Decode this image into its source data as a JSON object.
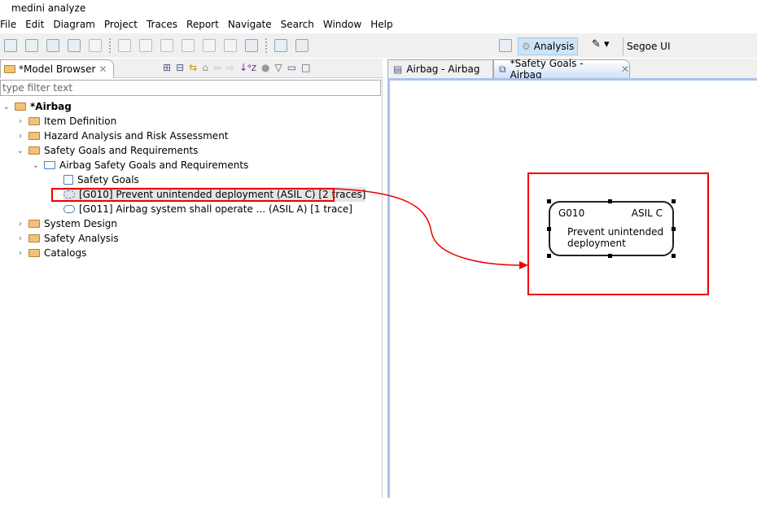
{
  "window": {
    "title": "medini analyze"
  },
  "menu": [
    "File",
    "Edit",
    "Diagram",
    "Project",
    "Traces",
    "Report",
    "Navigate",
    "Search",
    "Window",
    "Help"
  ],
  "toolbar": {
    "perspective": "Analysis",
    "font": "Segoe UI"
  },
  "model_browser": {
    "tab_label": "*Model Browser",
    "filter_placeholder": "type filter text",
    "tree": [
      {
        "label": "*Airbag",
        "level": 0,
        "expanded": true,
        "icon": "folder-open-icon"
      },
      {
        "label": "Item Definition",
        "level": 1,
        "icon": "folder-icon"
      },
      {
        "label": "Hazard Analysis and Risk Assessment",
        "level": 1,
        "icon": "folder-icon"
      },
      {
        "label": "Safety Goals and Requirements",
        "level": 1,
        "expanded": true,
        "icon": "folder-icon"
      },
      {
        "label": "Airbag Safety Goals and Requirements",
        "level": 2,
        "expanded": true,
        "icon": "package-icon"
      },
      {
        "label": "Safety Goals",
        "level": 3,
        "icon": "diagram-icon"
      },
      {
        "label": "[G010] Prevent unintended deployment (ASIL C) [2 traces]",
        "level": 3,
        "icon": "goal-icon",
        "selected": true
      },
      {
        "label": "[G011] Airbag system shall operate ... (ASIL A) [1 trace]",
        "level": 3,
        "icon": "goal-icon"
      },
      {
        "label": "System Design",
        "level": 1,
        "icon": "folder-icon"
      },
      {
        "label": "Safety Analysis",
        "level": 1,
        "icon": "folder-icon"
      },
      {
        "label": "Catalogs",
        "level": 1,
        "icon": "folder-icon"
      }
    ]
  },
  "editor": {
    "tabs": [
      {
        "label": "Airbag - Airbag",
        "active": false
      },
      {
        "label": "*Safety Goals - Airbag",
        "active": true
      }
    ],
    "goal": {
      "id": "G010",
      "asil": "ASIL C",
      "text": "Prevent unintended deployment"
    }
  },
  "colors": {
    "highlight": "#e00000",
    "selection_bg": "#cde4f7"
  }
}
